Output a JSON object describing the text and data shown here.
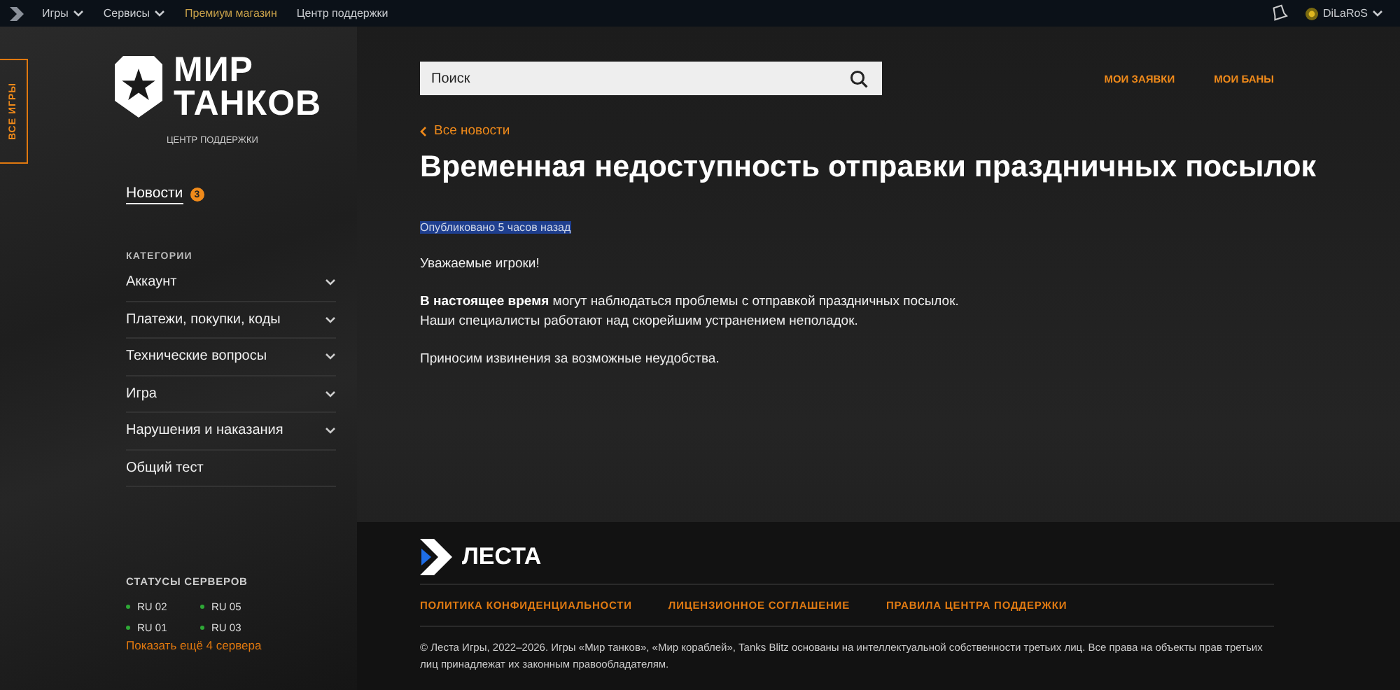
{
  "top_bar": {
    "menu": [
      {
        "label": "Игры",
        "dropdown": true,
        "highlighted": false
      },
      {
        "label": "Сервисы",
        "dropdown": true,
        "highlighted": false
      },
      {
        "label": "Премиум магазин",
        "dropdown": false,
        "highlighted": true
      },
      {
        "label": "Центр поддержки",
        "dropdown": false,
        "highlighted": false
      }
    ],
    "username": "DiLaRoS"
  },
  "sidebar": {
    "all_games_tab": "ВСЕ ИГРЫ",
    "logo": {
      "title_lines": [
        "МИР",
        "ТАНКОВ"
      ],
      "subtitle": "ЦЕНТР ПОДДЕРЖКИ"
    },
    "news": {
      "label": "Новости",
      "badge": "3",
      "selected": true
    },
    "categories": {
      "heading": "КАТЕГОРИИ",
      "items": [
        {
          "label": "Аккаунт",
          "expandable": true
        },
        {
          "label": "Платежи, покупки, коды",
          "expandable": true
        },
        {
          "label": "Технические вопросы",
          "expandable": true
        },
        {
          "label": "Игра",
          "expandable": true
        },
        {
          "label": "Нарушения и наказания",
          "expandable": true
        },
        {
          "label": "Общий тест",
          "expandable": false
        }
      ]
    },
    "servers": {
      "heading": "СТАТУСЫ СЕРВЕРОВ",
      "items": [
        {
          "name": "RU 02",
          "color": "#2ea836"
        },
        {
          "name": "RU 05",
          "color": "#2ea836"
        },
        {
          "name": "RU 01",
          "color": "#2ea836"
        },
        {
          "name": "RU 03",
          "color": "#2ea836"
        }
      ],
      "more_link": "Показать ещё 4 сервера"
    }
  },
  "main": {
    "search": {
      "placeholder": "Поиск"
    },
    "header_links": [
      "МОИ ЗАЯВКИ",
      "МОИ БАНЫ"
    ],
    "back_link": "Все новости",
    "title": "Временная недоступность отправки праздничных посылок",
    "published": {
      "text": "Опубликовано 5 часов назад",
      "highlighted": true
    },
    "paragraphs": [
      "Уважаемые игроки!",
      "**В настоящее время** могут наблюдаться проблемы с отправкой праздничных посылок.\nНаши специалисты работают над скорейшим устранением неполадок.",
      "Приносим извинения за возможные неудобства."
    ]
  },
  "footer": {
    "brand": "ЛЕСТА",
    "links": [
      "ПОЛИТИКА КОНФИДЕНЦИАЛЬНОСТИ",
      "ЛИЦЕНЗИОННОЕ СОГЛАШЕНИЕ",
      "ПРАВИЛА ЦЕНТРА ПОДДЕРЖКИ"
    ],
    "copyright": "© Леста Игры, 2022–2026. Игры «Мир танков», «Мир кораблей», Tanks Blitz основаны на интеллектуальной собственности третьих лиц. Все права на объекты прав третьих лиц принадлежат их законным правообладателям."
  }
}
